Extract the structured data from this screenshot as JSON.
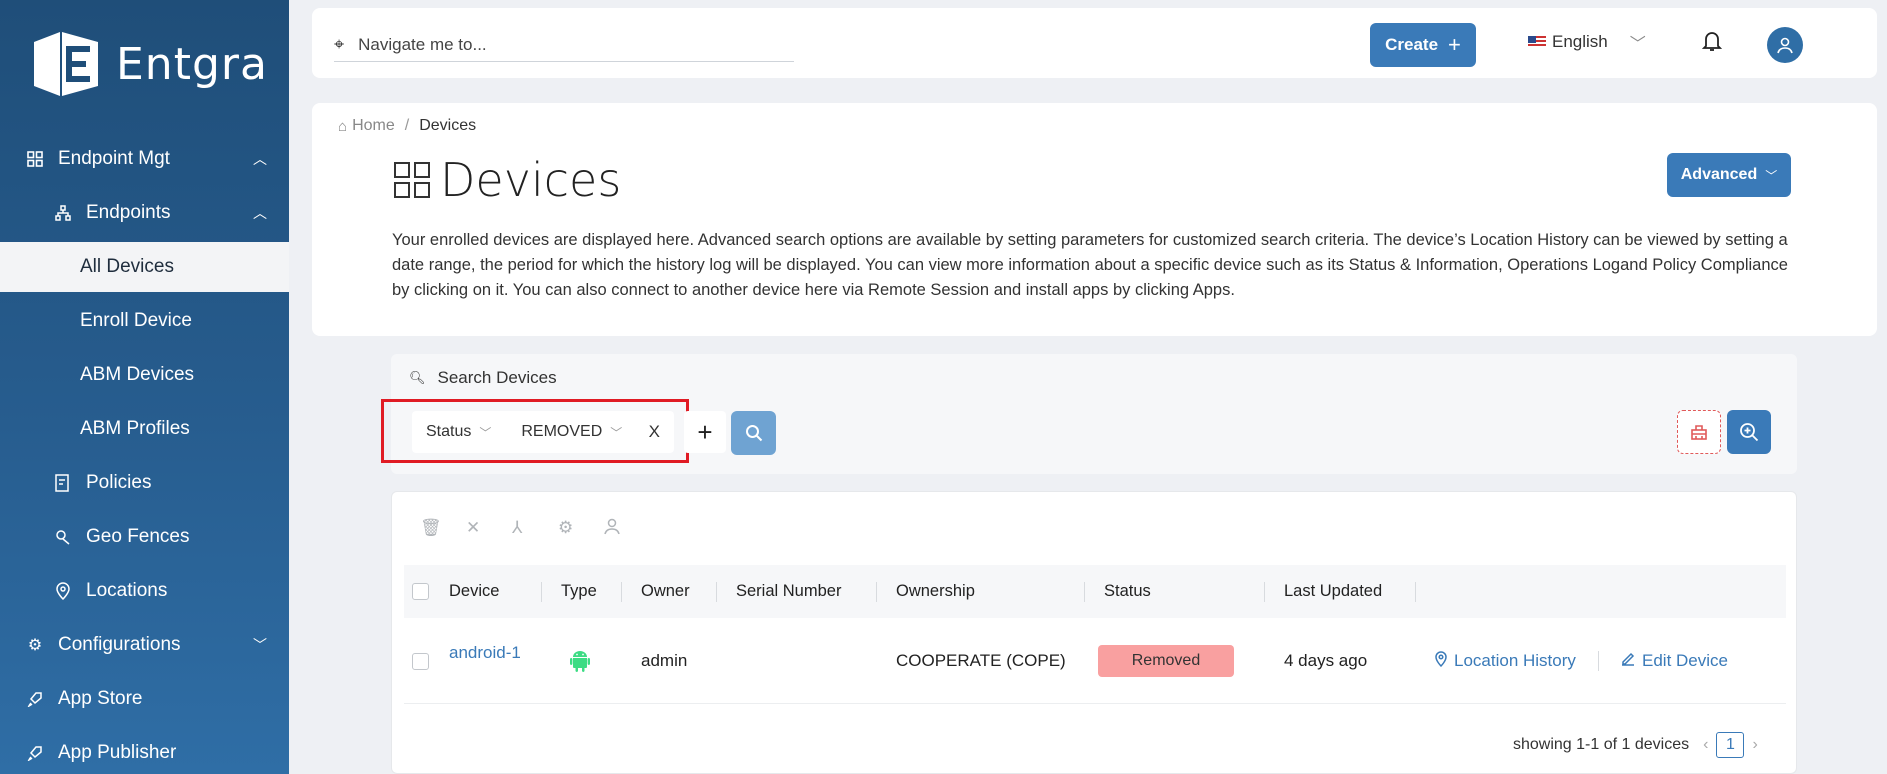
{
  "sidebar": {
    "logo_text": "Entgra",
    "items": [
      {
        "label": "Endpoint Mgt",
        "icon": "grid-icon"
      },
      {
        "label": "Endpoints",
        "icon": "hierarchy-icon"
      },
      {
        "label": "All Devices"
      },
      {
        "label": "Enroll Device"
      },
      {
        "label": "ABM Devices"
      },
      {
        "label": "ABM Profiles"
      },
      {
        "label": "Policies",
        "icon": "policy-icon"
      },
      {
        "label": "Geo Fences",
        "icon": "geofence-icon"
      },
      {
        "label": "Locations",
        "icon": "location-icon"
      },
      {
        "label": "Configurations",
        "icon": "gear-icon"
      },
      {
        "label": "App Store",
        "icon": "rocket-icon"
      },
      {
        "label": "App Publisher",
        "icon": "rocket-icon"
      }
    ]
  },
  "topbar": {
    "navigate_placeholder": "Navigate me to...",
    "create_label": "Create",
    "language": "English"
  },
  "breadcrumb": {
    "home": "Home",
    "current": "Devices"
  },
  "page": {
    "title": "Devices",
    "advanced_label": "Advanced",
    "description": "Your enrolled devices are displayed here. Advanced search options are available by setting parameters for customized search criteria. The device’s Location History can be viewed by setting a date range, the period for which the history log will be displayed. You can view more information about a specific device such as its Status & Information, Operations Logand Policy Compliance by clicking on it. You can also connect to another device here via Remote Session and install apps by clicking Apps."
  },
  "filter": {
    "search_label": "Search Devices",
    "field": "Status",
    "value": "REMOVED",
    "remove": "X"
  },
  "table": {
    "columns": [
      "Device",
      "Type",
      "Owner",
      "Serial Number",
      "Ownership",
      "Status",
      "Last Updated"
    ],
    "rows": [
      {
        "device": "android-1",
        "type_icon": "android-icon",
        "owner": "admin",
        "serial": "",
        "ownership": "COOPERATE (COPE)",
        "status": "Removed",
        "last_updated": "4 days ago",
        "action_location": "Location History",
        "action_edit": "Edit Device"
      }
    ],
    "pagination_text": "showing 1-1 of 1 devices",
    "current_page": "1"
  },
  "colors": {
    "primary": "#3a7ab8",
    "sidebar": "#1f4e79",
    "removed_badge": "#f9a0a0",
    "highlight_box": "#e01b24"
  }
}
